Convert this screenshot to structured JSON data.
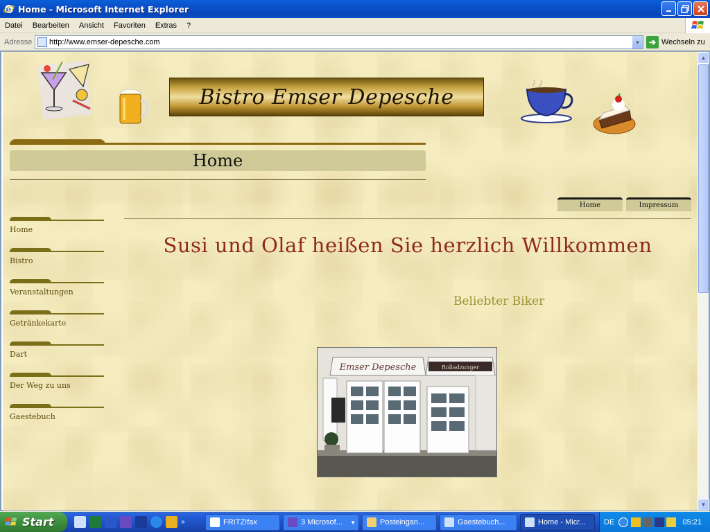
{
  "window": {
    "title": "Home - Microsoft Internet Explorer"
  },
  "menubar": {
    "items": [
      "Datei",
      "Bearbeiten",
      "Ansicht",
      "Favoriten",
      "Extras",
      "?"
    ]
  },
  "addressbar": {
    "label": "Adresse",
    "url": "http://www.emser-depesche.com",
    "go_label": "Wechseln zu"
  },
  "page": {
    "banner_text": "Bistro Emser Depesche",
    "header_title": "Home",
    "nav": [
      "Home",
      "Bistro",
      "Veranstaltungen",
      "Getränkekarte",
      "Dart",
      "Der Weg zu uns",
      "Gaestebuch"
    ],
    "top_tabs": [
      "Home",
      "Impressum"
    ],
    "welcome": "Susi und Olaf heißen Sie herzlich Willkommen",
    "subtitle": "Beliebter Biker",
    "photo_sign_left": "Emser Depesche",
    "photo_sign_right": "Rolladzunger"
  },
  "taskbar": {
    "start_label": "Start",
    "buttons": [
      "FRITZ!fax",
      "3 Microsof...",
      "Posteingan...",
      "Gaestebuch...",
      "Home - Micr..."
    ],
    "lang": "DE",
    "clock": "05:21"
  },
  "colors": {
    "welcome": "#8f2a1c",
    "subtitle": "#9a9030",
    "nav_text": "#5a4a0a"
  }
}
